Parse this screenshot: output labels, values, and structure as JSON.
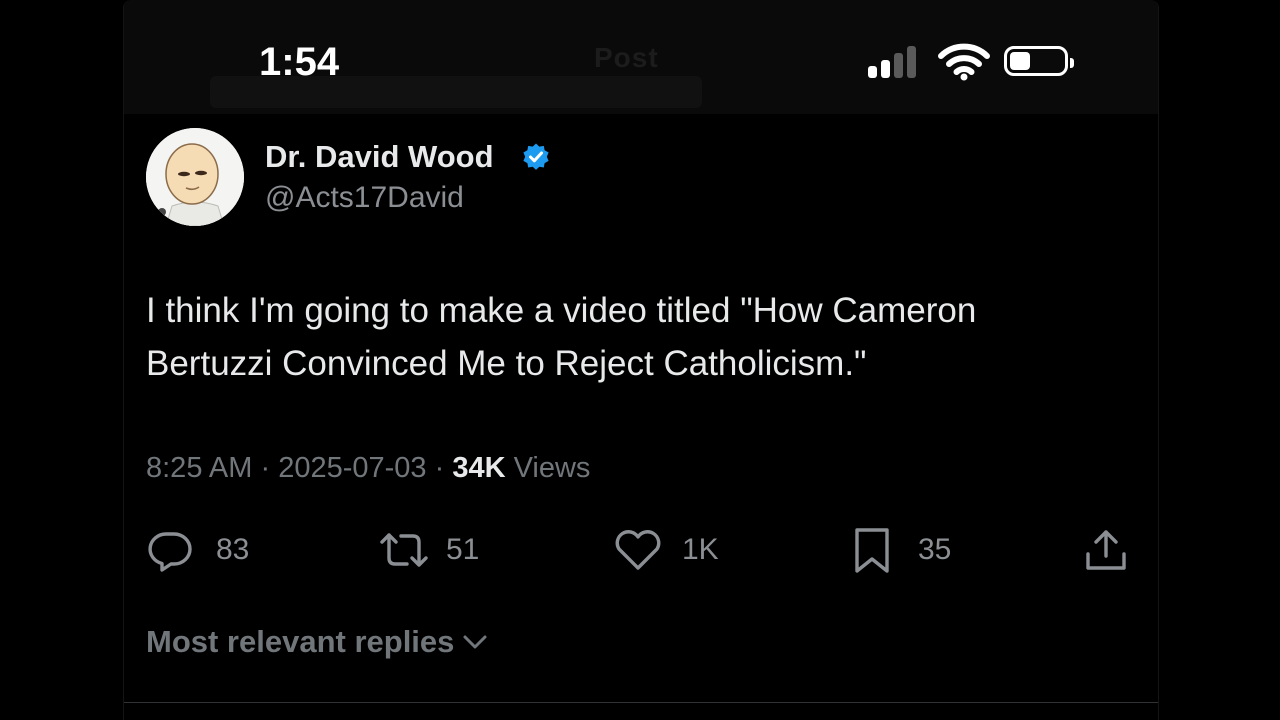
{
  "status_bar": {
    "time": "1:54"
  },
  "header": {
    "title": "Post"
  },
  "author": {
    "display_name": "Dr. David Wood",
    "handle": "@Acts17David",
    "verified_color": "#1d9bf0"
  },
  "tweet": {
    "text": "I think I'm going to make a video titled \"How Cameron Bertuzzi Convinced Me to Reject Catholicism.\"",
    "time": "8:25 AM",
    "date": "2025-07-03",
    "views_count": "34K",
    "views_label": "Views"
  },
  "actions": {
    "replies": "83",
    "reposts": "51",
    "likes": "1K",
    "bookmarks": "35"
  },
  "replies_sort": {
    "label": "Most relevant replies"
  },
  "icons": {
    "reply": "reply-icon",
    "repost": "repost-icon",
    "like": "heart-icon",
    "bookmark": "bookmark-icon",
    "share": "share-icon",
    "chevron": "chevron-down-icon"
  }
}
